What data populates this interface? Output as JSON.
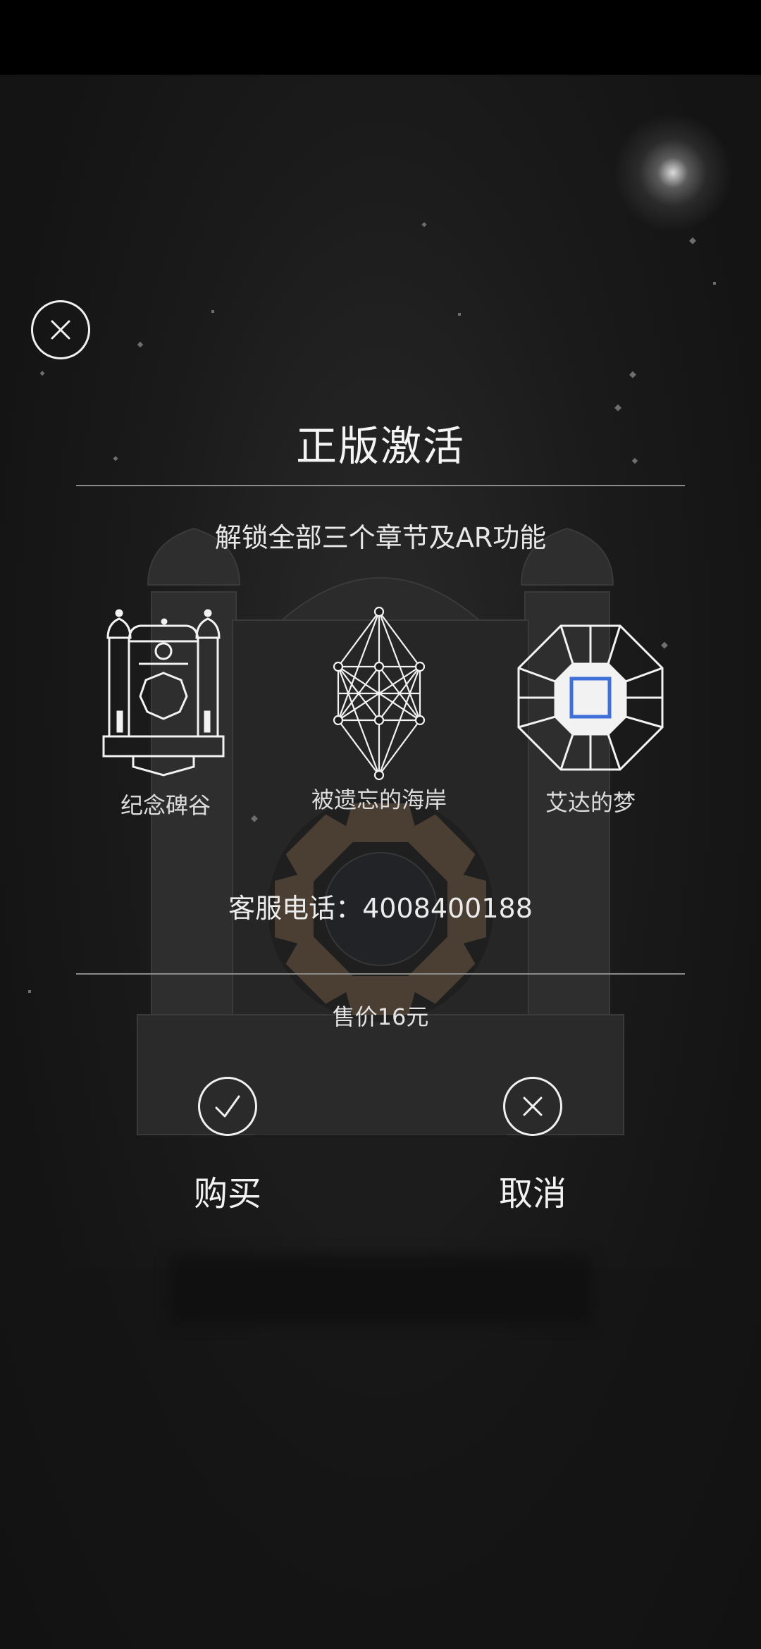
{
  "dialog": {
    "title": "正版激活",
    "subtitle": "解锁全部三个章节及AR功能",
    "chapters": [
      {
        "label": "纪念碑谷",
        "icon": "monument-valley-temple-icon"
      },
      {
        "label": "被遗忘的海岸",
        "icon": "forgotten-shores-sacred-geometry-icon"
      },
      {
        "label": "艾达的梦",
        "icon": "idas-dream-octagon-icon"
      }
    ],
    "phone": "客服电话：4008400188",
    "price": "售价16元",
    "buy_label": "购买",
    "cancel_label": "取消"
  },
  "colors": {
    "background": "#111111",
    "text": "#f0f0f0",
    "accent": "#3f6fd8"
  }
}
